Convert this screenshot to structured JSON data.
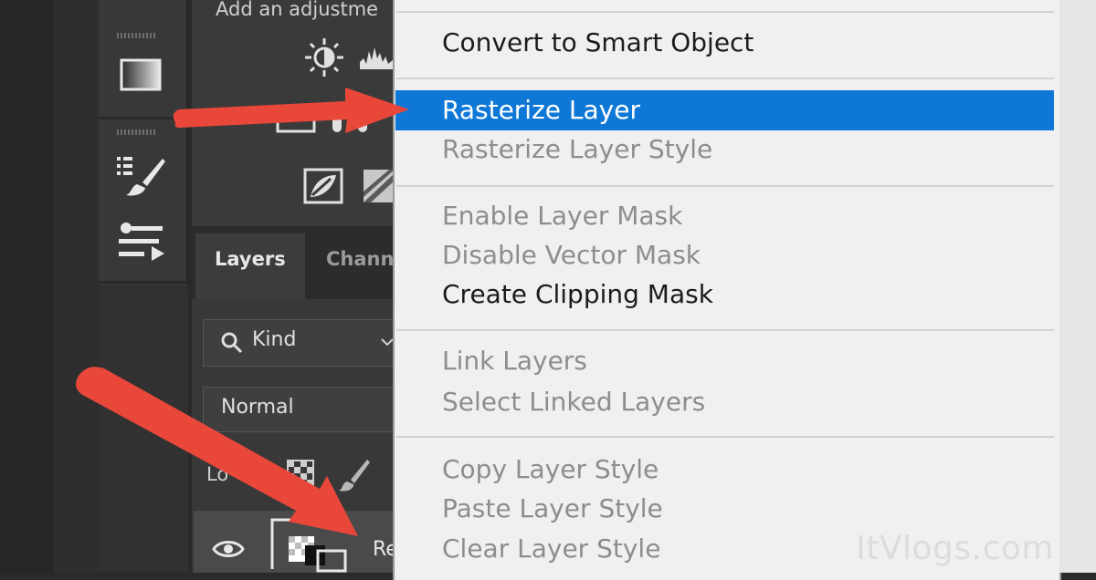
{
  "adjustments_panel": {
    "hint": "Add an adjustme"
  },
  "layers_panel": {
    "tabs": [
      {
        "label": "Layers",
        "active": true
      },
      {
        "label": "Chann",
        "active": false
      }
    ],
    "filter_kind": "Kind",
    "blend_mode": "Normal",
    "lock_label": "Lo",
    "layer_name": "Re"
  },
  "context_menu": {
    "items": [
      {
        "label": "Convert to Smart Object",
        "enabled": true,
        "highlighted": false
      },
      {
        "label": "Rasterize Layer",
        "enabled": true,
        "highlighted": true
      },
      {
        "label": "Rasterize Layer Style",
        "enabled": false,
        "highlighted": false
      },
      {
        "label": "Enable Layer Mask",
        "enabled": false,
        "highlighted": false
      },
      {
        "label": "Disable Vector Mask",
        "enabled": false,
        "highlighted": false
      },
      {
        "label": "Create Clipping Mask",
        "enabled": true,
        "highlighted": false
      },
      {
        "label": "Link Layers",
        "enabled": false,
        "highlighted": false
      },
      {
        "label": "Select Linked Layers",
        "enabled": false,
        "highlighted": false
      },
      {
        "label": "Copy Layer Style",
        "enabled": false,
        "highlighted": false
      },
      {
        "label": "Paste Layer Style",
        "enabled": false,
        "highlighted": false
      },
      {
        "label": "Clear Layer Style",
        "enabled": false,
        "highlighted": false
      }
    ]
  },
  "watermark": "ItVlogs.com",
  "colors": {
    "menu_bg": "#f0f0f0",
    "highlight": "#0f78d7",
    "arrow": "#e8473a",
    "panel_dark": "#383838"
  },
  "icons": [
    "gradient-icon",
    "brush-settings-icon",
    "sliders-icon",
    "brightness-icon",
    "levels-icon",
    "search-icon",
    "eye-icon",
    "checkerboard-lock-icon",
    "brush-lock-icon",
    "chevron-down-icon"
  ]
}
